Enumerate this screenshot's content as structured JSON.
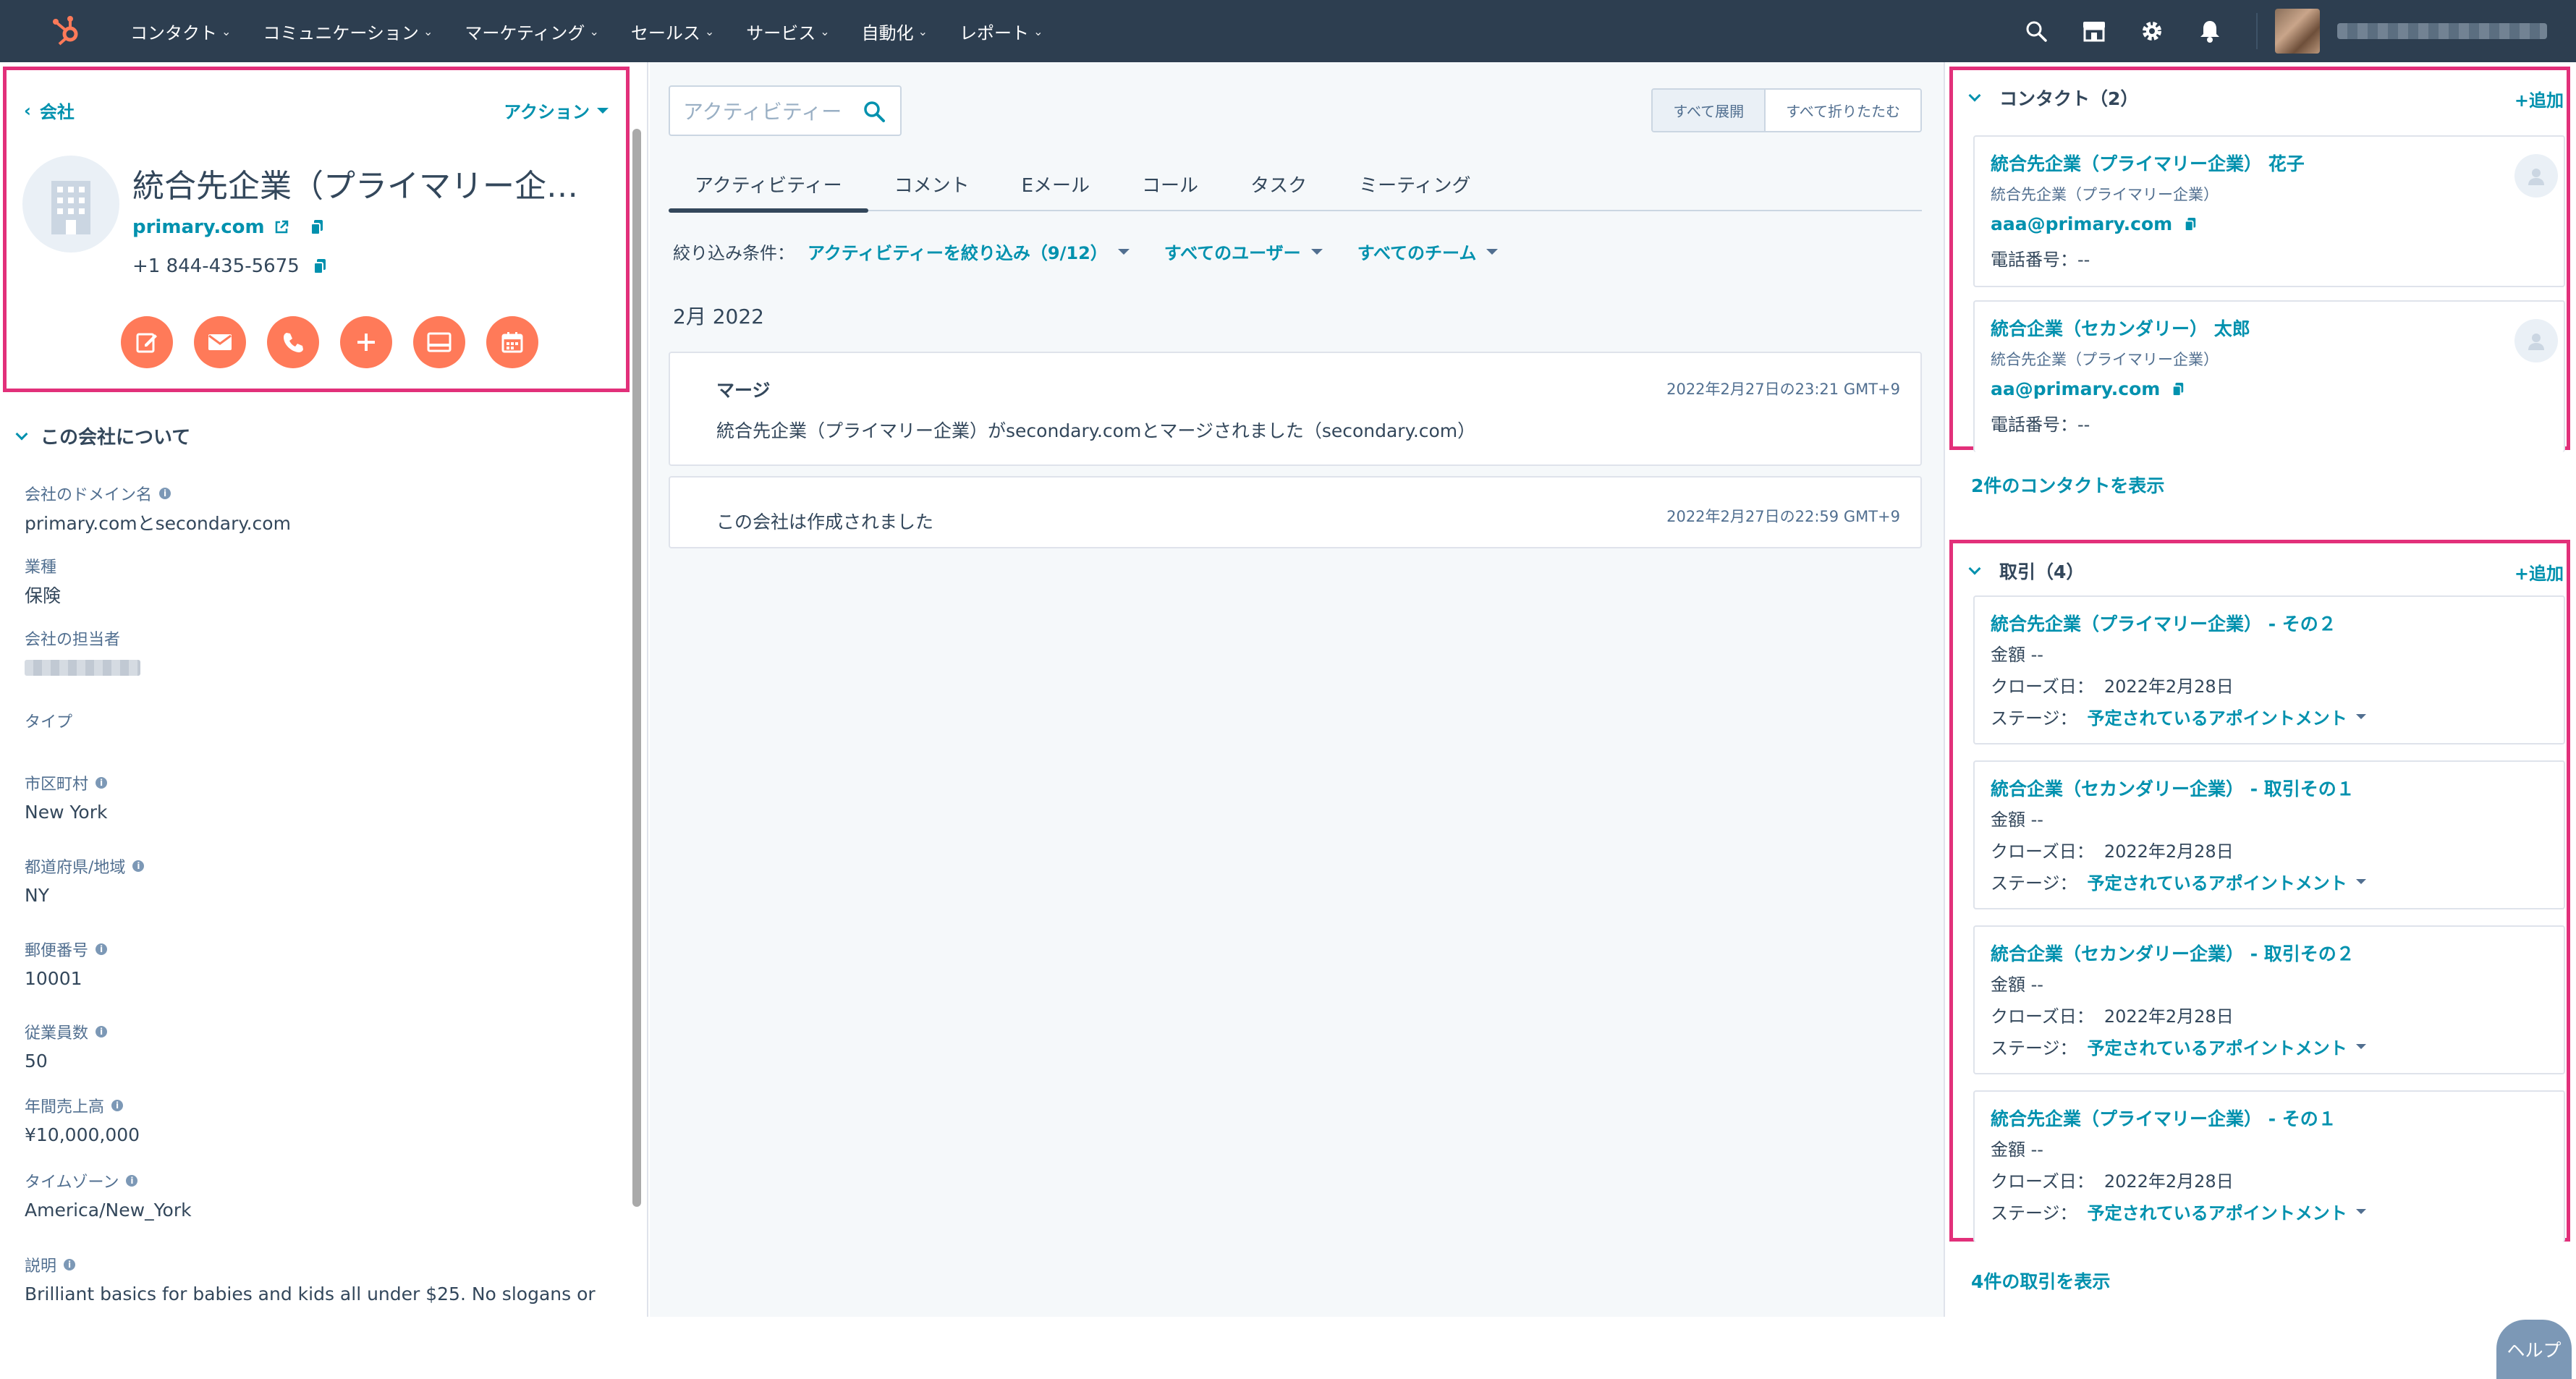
{
  "nav": {
    "items": [
      "コンタクト",
      "コミュニケーション",
      "マーケティング",
      "セールス",
      "サービス",
      "自動化",
      "レポート"
    ],
    "brand_color": "#ff7a59",
    "bg_color": "#2d3e50"
  },
  "profile": {
    "back_label": "会社",
    "actions_label": "アクション",
    "company_name": "統合先企業（プライマリー企…",
    "domain": "primary.com",
    "phone": "+1 844-435-5675"
  },
  "about": {
    "header": "この会社について",
    "properties": [
      {
        "label": "会社のドメイン名",
        "value": "primary.comとsecondary.com",
        "info": true
      },
      {
        "label": "業種",
        "value": "保険",
        "info": false
      },
      {
        "label": "会社の担当者",
        "value": "",
        "info": false
      },
      {
        "label": "タイプ",
        "value": "",
        "info": false
      },
      {
        "label": "市区町村",
        "value": "New York",
        "info": true
      },
      {
        "label": "都道府県/地域",
        "value": "NY",
        "info": true
      },
      {
        "label": "郵便番号",
        "value": "10001",
        "info": true
      },
      {
        "label": "従業員数",
        "value": "50",
        "info": true
      },
      {
        "label": "年間売上高",
        "value": "¥10,000,000",
        "info": true
      },
      {
        "label": "タイムゾーン",
        "value": "America/New_York",
        "info": true
      },
      {
        "label": "説明",
        "value": "Brilliant basics for babies and kids all under $25. No slogans or",
        "info": true
      }
    ]
  },
  "activity": {
    "search_placeholder": "アクティビティー",
    "expand_all": "すべて展開",
    "collapse_all": "すべて折りたたむ",
    "tabs": [
      "アクティビティー",
      "コメント",
      "Eメール",
      "コール",
      "タスク",
      "ミーティング"
    ],
    "filter_label": "絞り込み条件：",
    "filter_activity": "アクティビティーを絞り込み（9/12）",
    "filter_users": "すべてのユーザー",
    "filter_teams": "すべてのチーム",
    "month": "2月 2022",
    "items": [
      {
        "title": "マージ",
        "time": "2022年2月27日の23:21 GMT+9",
        "body": "統合先企業（プライマリー企業）がsecondary.comとマージされました（secondary.com）"
      },
      {
        "title": "",
        "time": "2022年2月27日の22:59 GMT+9",
        "body": "この会社は作成されました"
      }
    ]
  },
  "contacts": {
    "header": "コンタクト（2）",
    "add_label": "+追加",
    "items": [
      {
        "name": "統合先企業（プライマリー企業） 花子",
        "company": "統合先企業（プライマリー企業）",
        "email": "aaa@primary.com",
        "phone": "電話番号：--"
      },
      {
        "name": "統合企業（セカンダリー） 太郎",
        "company": "統合先企業（プライマリー企業）",
        "email": "aa@primary.com",
        "phone": "電話番号：--"
      }
    ],
    "show_all": "2件のコンタクトを表示"
  },
  "deals": {
    "header": "取引（4）",
    "add_label": "+追加",
    "amount_label": "金額 --",
    "close_label": "クローズ日：",
    "stage_label": "ステージ：",
    "items": [
      {
        "name": "統合先企業（プライマリー企業） - その２",
        "close_date": "2022年2月28日",
        "stage": "予定されているアポイントメント"
      },
      {
        "name": "統合企業（セカンダリー企業） - 取引その１",
        "close_date": "2022年2月28日",
        "stage": "予定されているアポイントメント"
      },
      {
        "name": "統合企業（セカンダリー企業） - 取引その２",
        "close_date": "2022年2月28日",
        "stage": "予定されているアポイントメント"
      },
      {
        "name": "統合先企業（プライマリー企業） - その１",
        "close_date": "2022年2月28日",
        "stage": "予定されているアポイントメント"
      }
    ],
    "show_all": "4件の取引を表示"
  },
  "help_label": "ヘルプ",
  "highlight_color": "#e2307a",
  "accent_color": "#0091ae"
}
